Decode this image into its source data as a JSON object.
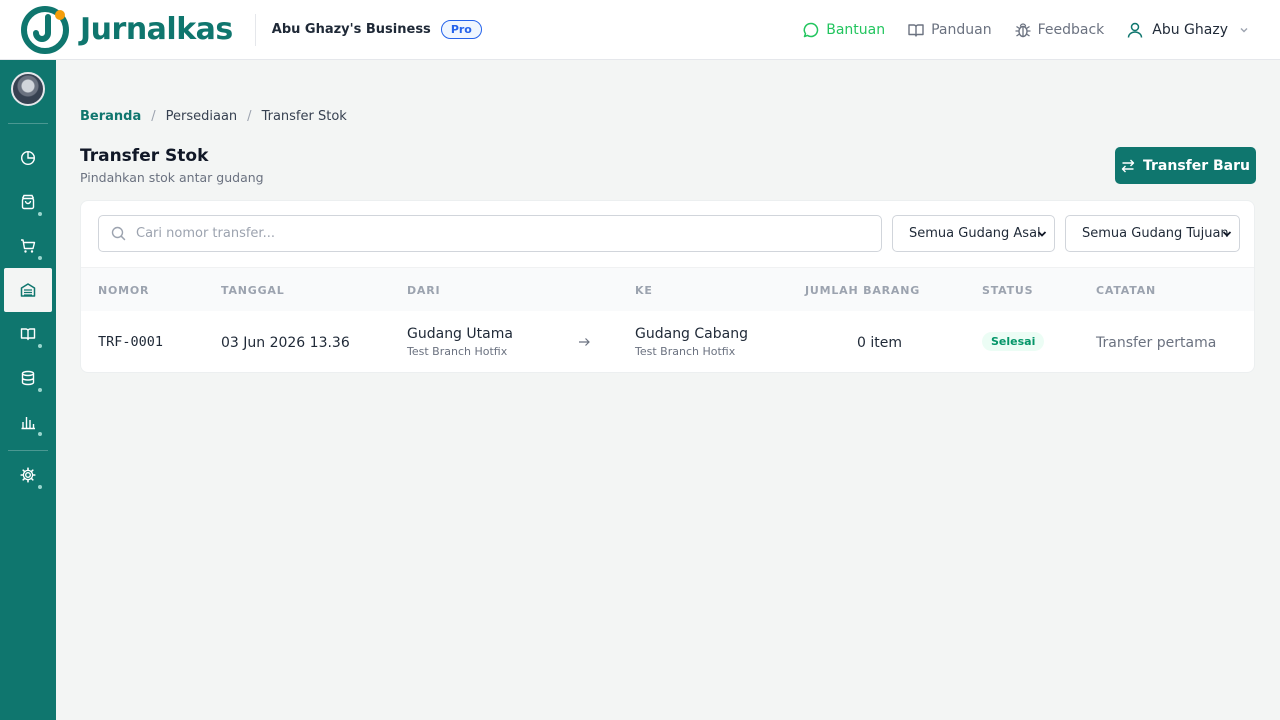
{
  "brand": {
    "name": "Jurnalkas",
    "accent": "#0f766e",
    "dot": "#f59e0b"
  },
  "header": {
    "business_name": "Abu Ghazy's Business",
    "plan_badge": "Pro",
    "links": {
      "help": "Bantuan",
      "guide": "Panduan",
      "feedback": "Feedback"
    },
    "user_name": "Abu Ghazy"
  },
  "sidebar": {
    "items": [
      {
        "icon": "dashboard-pie-icon",
        "active": false
      },
      {
        "icon": "shopping-bag-icon",
        "active": false
      },
      {
        "icon": "cart-icon",
        "active": false
      },
      {
        "icon": "inventory-icon",
        "active": true
      },
      {
        "icon": "book-icon",
        "active": false
      },
      {
        "icon": "database-icon",
        "active": false
      },
      {
        "icon": "bar-chart-icon",
        "active": false
      },
      {
        "icon": "settings-gear-icon",
        "active": false
      }
    ]
  },
  "breadcrumb": {
    "home": "Beranda",
    "section": "Persediaan",
    "current": "Transfer Stok"
  },
  "page": {
    "title": "Transfer Stok",
    "subtitle": "Pindahkan stok antar gudang",
    "new_button": "Transfer Baru"
  },
  "filters": {
    "search_placeholder": "Cari nomor transfer...",
    "source_warehouse": "Semua Gudang Asal",
    "destination_warehouse": "Semua Gudang Tujuan"
  },
  "table": {
    "columns": [
      "NOMOR",
      "TANGGAL",
      "DARI",
      "KE",
      "JUMLAH BARANG",
      "STATUS",
      "CATATAN"
    ],
    "rows": [
      {
        "number": "TRF-0001",
        "date": "03 Jun 2026 13.36",
        "from_name": "Gudang Utama",
        "from_branch": "Test Branch Hotfix",
        "to_name": "Gudang Cabang",
        "to_branch": "Test Branch Hotfix",
        "item_count": "0 item",
        "status": "Selesai",
        "note": "Transfer pertama"
      }
    ]
  }
}
